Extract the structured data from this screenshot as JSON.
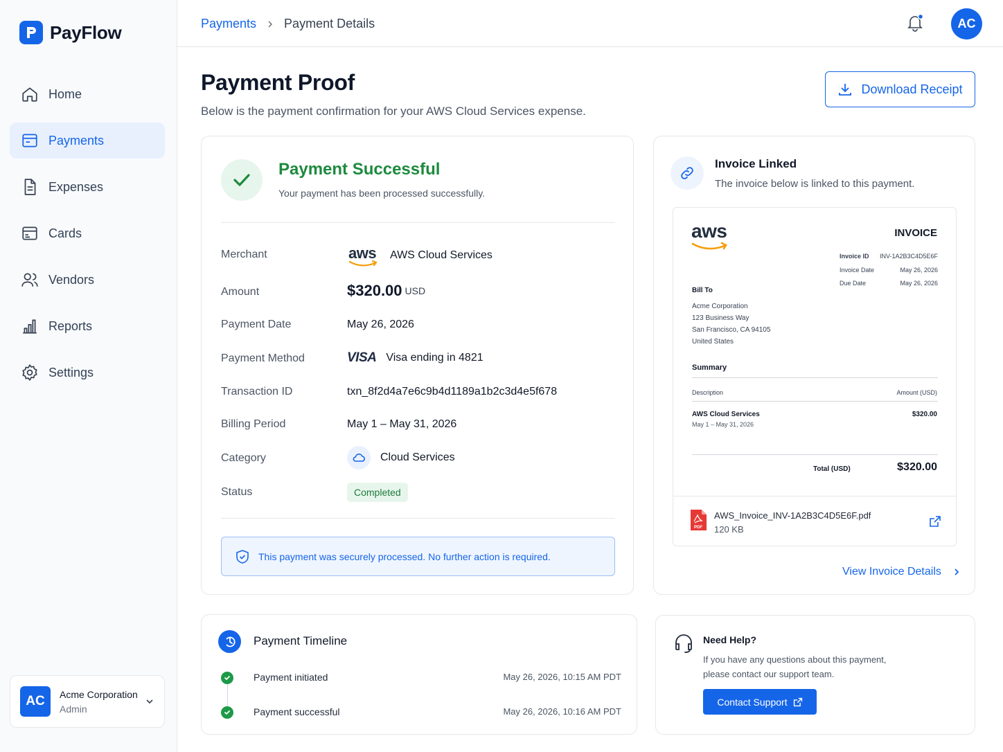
{
  "app": {
    "name": "PayFlow"
  },
  "sidebar": {
    "items": [
      {
        "label": "Home",
        "icon": "home-icon"
      },
      {
        "label": "Payments",
        "icon": "payments-icon"
      },
      {
        "label": "Expenses",
        "icon": "expenses-icon"
      },
      {
        "label": "Cards",
        "icon": "cards-icon"
      },
      {
        "label": "Vendors",
        "icon": "vendors-icon"
      },
      {
        "label": "Reports",
        "icon": "reports-icon"
      },
      {
        "label": "Settings",
        "icon": "settings-icon"
      }
    ],
    "active": "Payments",
    "account": {
      "initials": "AC",
      "name": "Acme Corporation",
      "role": "Admin"
    }
  },
  "header": {
    "breadcrumb": {
      "parent": "Payments",
      "current": "Payment Details"
    },
    "avatar": "AC"
  },
  "page": {
    "title": "Payment Proof",
    "subtitle": "Below is the payment confirmation for your AWS Cloud Services expense.",
    "download_label": "Download Receipt"
  },
  "payment": {
    "status_title": "Payment Successful",
    "status_sub": "Your payment has been processed successfully.",
    "labels": {
      "merchant": "Merchant",
      "amount": "Amount",
      "date": "Payment Date",
      "method": "Payment Method",
      "txn": "Transaction ID",
      "period": "Billing Period",
      "category": "Category",
      "status": "Status"
    },
    "merchant_logo": "aws",
    "merchant": "AWS Cloud Services",
    "amount": "$320.00",
    "currency": "USD",
    "date": "May 26, 2026",
    "card_brand": "VISA",
    "method": "Visa ending in 4821",
    "txn": "txn_8f2d4a7e6c9b4d1189a1b2c3d4e5f678",
    "period": "May 1 – May 31, 2026",
    "category": "Cloud Services",
    "status": "Completed",
    "secure_note": "This payment was securely processed. No further action is required."
  },
  "invoice_card": {
    "title": "Invoice Linked",
    "subtitle": "The invoice below is linked to this payment.",
    "doc": {
      "logo": "aws",
      "heading": "INVOICE",
      "meta": [
        {
          "label": "Invoice ID",
          "value": "INV-1A2B3C4D5E6F"
        },
        {
          "label": "Invoice Date",
          "value": "May 26, 2026"
        },
        {
          "label": "Due Date",
          "value": "May 26, 2026"
        }
      ],
      "bill_to_label": "Bill To",
      "bill_to": [
        "Acme Corporation",
        "123 Business Way",
        "San Francisco, CA 94105",
        "United States"
      ],
      "summary_label": "Summary",
      "col_desc": "Description",
      "col_amt": "Amount (USD)",
      "item_name": "AWS Cloud Services",
      "item_period": "May 1 – May 31, 2026",
      "item_amount": "$320.00",
      "total_label": "Total (USD)",
      "total": "$320.00"
    },
    "file": {
      "name": "AWS_Invoice_INV-1A2B3C4D5E6F.pdf",
      "size": "120 KB",
      "type_label": "PDF"
    },
    "view_label": "View Invoice Details"
  },
  "timeline": {
    "title": "Payment Timeline",
    "events": [
      {
        "label": "Payment initiated",
        "time": "May 26, 2026, 10:15 AM PDT"
      },
      {
        "label": "Payment successful",
        "time": "May 26, 2026, 10:16 AM PDT"
      }
    ]
  },
  "help": {
    "title": "Need Help?",
    "text": "If you have any questions about this payment, please contact our support team.",
    "button": "Contact Support"
  },
  "colors": {
    "primary": "#1565e8",
    "success": "#1d8a3e",
    "success_bg": "#e7f6ec"
  }
}
